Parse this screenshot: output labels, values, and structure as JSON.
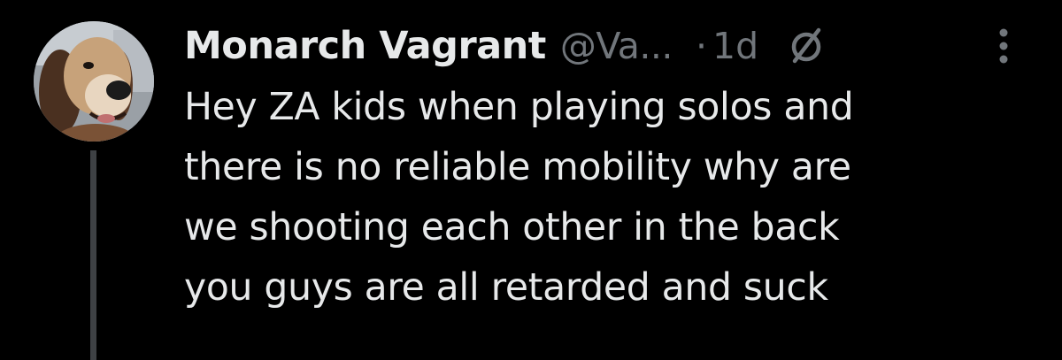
{
  "tweet": {
    "author": {
      "display_name": "Monarch Vagrant",
      "handle": "@Va...",
      "avatar_icon": "dog-avatar"
    },
    "separator": "·",
    "timestamp": "1d",
    "community_icon": "community-slash-circle-icon",
    "more_icon": "more-vertical-icon",
    "text_lines": [
      "Hey ZA kids when playing solos and",
      "there is no reliable mobility why are",
      "we shooting each other in the back",
      "you guys are all retarded and suck"
    ]
  },
  "colors": {
    "background": "#000000",
    "primary_text": "#e7e9ea",
    "secondary_text": "#71767b",
    "thread_line": "#3e4144"
  }
}
